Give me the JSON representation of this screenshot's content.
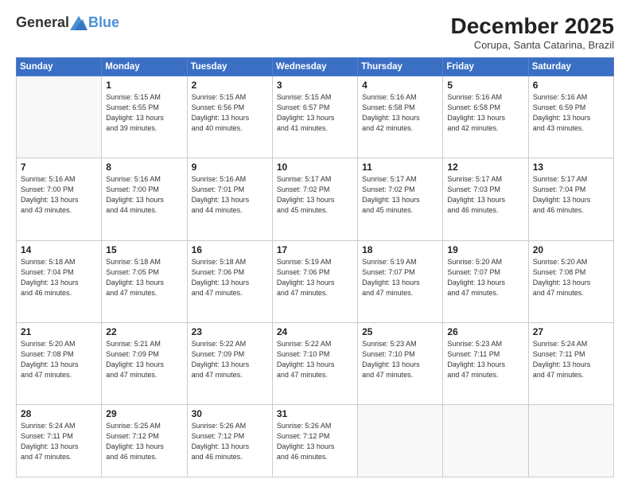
{
  "logo": {
    "general": "General",
    "blue": "Blue"
  },
  "title": "December 2025",
  "subtitle": "Corupa, Santa Catarina, Brazil",
  "days_of_week": [
    "Sunday",
    "Monday",
    "Tuesday",
    "Wednesday",
    "Thursday",
    "Friday",
    "Saturday"
  ],
  "weeks": [
    [
      {
        "day": "",
        "text": ""
      },
      {
        "day": "1",
        "text": "Sunrise: 5:15 AM\nSunset: 6:55 PM\nDaylight: 13 hours\nand 39 minutes."
      },
      {
        "day": "2",
        "text": "Sunrise: 5:15 AM\nSunset: 6:56 PM\nDaylight: 13 hours\nand 40 minutes."
      },
      {
        "day": "3",
        "text": "Sunrise: 5:15 AM\nSunset: 6:57 PM\nDaylight: 13 hours\nand 41 minutes."
      },
      {
        "day": "4",
        "text": "Sunrise: 5:16 AM\nSunset: 6:58 PM\nDaylight: 13 hours\nand 42 minutes."
      },
      {
        "day": "5",
        "text": "Sunrise: 5:16 AM\nSunset: 6:58 PM\nDaylight: 13 hours\nand 42 minutes."
      },
      {
        "day": "6",
        "text": "Sunrise: 5:16 AM\nSunset: 6:59 PM\nDaylight: 13 hours\nand 43 minutes."
      }
    ],
    [
      {
        "day": "7",
        "text": "Sunrise: 5:16 AM\nSunset: 7:00 PM\nDaylight: 13 hours\nand 43 minutes."
      },
      {
        "day": "8",
        "text": "Sunrise: 5:16 AM\nSunset: 7:00 PM\nDaylight: 13 hours\nand 44 minutes."
      },
      {
        "day": "9",
        "text": "Sunrise: 5:16 AM\nSunset: 7:01 PM\nDaylight: 13 hours\nand 44 minutes."
      },
      {
        "day": "10",
        "text": "Sunrise: 5:17 AM\nSunset: 7:02 PM\nDaylight: 13 hours\nand 45 minutes."
      },
      {
        "day": "11",
        "text": "Sunrise: 5:17 AM\nSunset: 7:02 PM\nDaylight: 13 hours\nand 45 minutes."
      },
      {
        "day": "12",
        "text": "Sunrise: 5:17 AM\nSunset: 7:03 PM\nDaylight: 13 hours\nand 46 minutes."
      },
      {
        "day": "13",
        "text": "Sunrise: 5:17 AM\nSunset: 7:04 PM\nDaylight: 13 hours\nand 46 minutes."
      }
    ],
    [
      {
        "day": "14",
        "text": "Sunrise: 5:18 AM\nSunset: 7:04 PM\nDaylight: 13 hours\nand 46 minutes."
      },
      {
        "day": "15",
        "text": "Sunrise: 5:18 AM\nSunset: 7:05 PM\nDaylight: 13 hours\nand 47 minutes."
      },
      {
        "day": "16",
        "text": "Sunrise: 5:18 AM\nSunset: 7:06 PM\nDaylight: 13 hours\nand 47 minutes."
      },
      {
        "day": "17",
        "text": "Sunrise: 5:19 AM\nSunset: 7:06 PM\nDaylight: 13 hours\nand 47 minutes."
      },
      {
        "day": "18",
        "text": "Sunrise: 5:19 AM\nSunset: 7:07 PM\nDaylight: 13 hours\nand 47 minutes."
      },
      {
        "day": "19",
        "text": "Sunrise: 5:20 AM\nSunset: 7:07 PM\nDaylight: 13 hours\nand 47 minutes."
      },
      {
        "day": "20",
        "text": "Sunrise: 5:20 AM\nSunset: 7:08 PM\nDaylight: 13 hours\nand 47 minutes."
      }
    ],
    [
      {
        "day": "21",
        "text": "Sunrise: 5:20 AM\nSunset: 7:08 PM\nDaylight: 13 hours\nand 47 minutes."
      },
      {
        "day": "22",
        "text": "Sunrise: 5:21 AM\nSunset: 7:09 PM\nDaylight: 13 hours\nand 47 minutes."
      },
      {
        "day": "23",
        "text": "Sunrise: 5:22 AM\nSunset: 7:09 PM\nDaylight: 13 hours\nand 47 minutes."
      },
      {
        "day": "24",
        "text": "Sunrise: 5:22 AM\nSunset: 7:10 PM\nDaylight: 13 hours\nand 47 minutes."
      },
      {
        "day": "25",
        "text": "Sunrise: 5:23 AM\nSunset: 7:10 PM\nDaylight: 13 hours\nand 47 minutes."
      },
      {
        "day": "26",
        "text": "Sunrise: 5:23 AM\nSunset: 7:11 PM\nDaylight: 13 hours\nand 47 minutes."
      },
      {
        "day": "27",
        "text": "Sunrise: 5:24 AM\nSunset: 7:11 PM\nDaylight: 13 hours\nand 47 minutes."
      }
    ],
    [
      {
        "day": "28",
        "text": "Sunrise: 5:24 AM\nSunset: 7:11 PM\nDaylight: 13 hours\nand 47 minutes."
      },
      {
        "day": "29",
        "text": "Sunrise: 5:25 AM\nSunset: 7:12 PM\nDaylight: 13 hours\nand 46 minutes."
      },
      {
        "day": "30",
        "text": "Sunrise: 5:26 AM\nSunset: 7:12 PM\nDaylight: 13 hours\nand 46 minutes."
      },
      {
        "day": "31",
        "text": "Sunrise: 5:26 AM\nSunset: 7:12 PM\nDaylight: 13 hours\nand 46 minutes."
      },
      {
        "day": "",
        "text": ""
      },
      {
        "day": "",
        "text": ""
      },
      {
        "day": "",
        "text": ""
      }
    ]
  ]
}
